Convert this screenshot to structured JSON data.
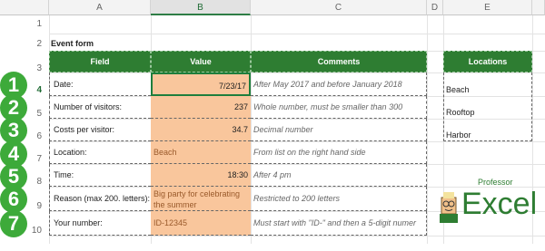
{
  "columns": [
    "A",
    "B",
    "C",
    "D",
    "E"
  ],
  "rows": [
    "1",
    "2",
    "3",
    "4",
    "5",
    "6",
    "7",
    "8",
    "9",
    "10"
  ],
  "title": "Event form",
  "headers": {
    "field": "Field",
    "value": "Value",
    "comments": "Comments",
    "locations": "Locations"
  },
  "form": [
    {
      "num": "1",
      "field": "Date:",
      "value": "7/23/17",
      "comment": "After May 2017 and before January 2018"
    },
    {
      "num": "2",
      "field": "Number of visitors:",
      "value": "237",
      "comment": "Whole number, must be smaller than 300"
    },
    {
      "num": "3",
      "field": "Costs per visitor:",
      "value": "34.7",
      "comment": "Decimal number"
    },
    {
      "num": "4",
      "field": "Location:",
      "value": "Beach",
      "comment": "From list on the right hand side"
    },
    {
      "num": "5",
      "field": "Time:",
      "value": "18:30",
      "comment": "After 4 pm"
    },
    {
      "num": "6",
      "field": "Reason (max 200. letters):",
      "value_line1": "Big party for celebrating",
      "value_line2": "the summer",
      "comment": "Restricted to 200 letters"
    },
    {
      "num": "7",
      "field": "Your number:",
      "value": "ID-12345",
      "comment": "Must start with \"ID-\" and then a 5-digit numer"
    }
  ],
  "locations": [
    "Beach",
    "Rooftop",
    "Harbor"
  ],
  "logo": {
    "line1": "Professor",
    "line2": "Excel"
  },
  "colors": {
    "green": "#2e7d32",
    "orange": "#f9c69c",
    "badge": "#3daa3a"
  }
}
